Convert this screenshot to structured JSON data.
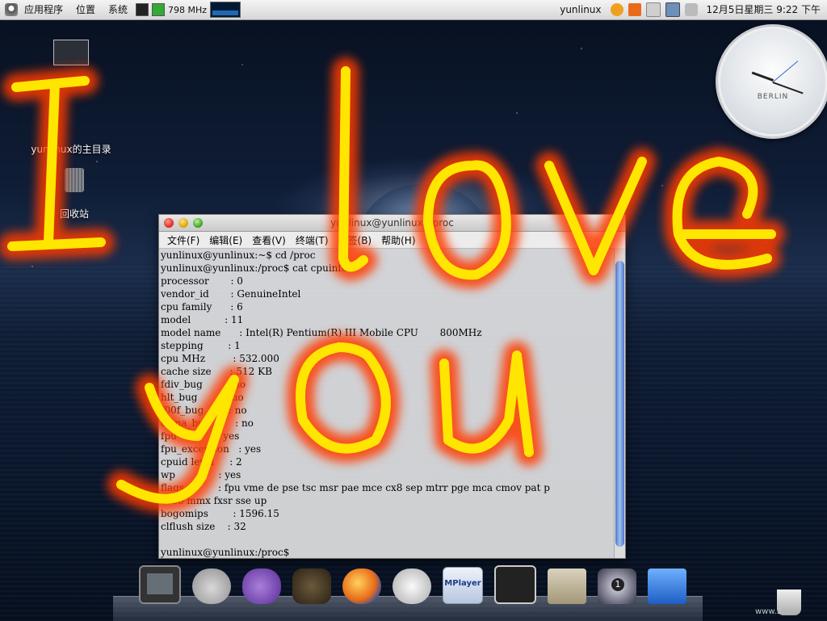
{
  "panel": {
    "menu_apps": "应用程序",
    "menu_places": "位置",
    "menu_system": "系统",
    "cpu_freq": "798 MHz",
    "username": "yunlinux",
    "datetime": "12月5日星期三  9:22 下午"
  },
  "desktop": {
    "home_label": "yunlinux的主目录",
    "trash_label": "回收站"
  },
  "clock": {
    "city": "BERLIN"
  },
  "terminal": {
    "title": "yunlinux@yunlinux: /proc",
    "menu": [
      "文件(F)",
      "编辑(E)",
      "查看(V)",
      "终端(T)",
      "标签(B)",
      "帮助(H)"
    ],
    "lines": [
      "yunlinux@yunlinux:~$ cd /proc",
      "yunlinux@yunlinux:/proc$ cat cpuinfo",
      "processor       : 0",
      "vendor_id       : GenuineIntel",
      "cpu family      : 6",
      "model           : 11",
      "model name      : Intel(R) Pentium(R) III Mobile CPU       800MHz",
      "stepping        : 1",
      "cpu MHz         : 532.000",
      "cache size      : 512 KB",
      "fdiv_bug        : no",
      "hlt_bug         : no",
      "f00f_bug        : no",
      "coma_bug        : no",
      "fpu             : yes",
      "fpu_exception   : yes",
      "cpuid level     : 2",
      "wp              : yes",
      "flags           : fpu vme de pse tsc msr pae mce cx8 sep mtrr pge mca cmov pat p",
      "se36 mmx fxsr sse up",
      "bogomips        : 1596.15",
      "clflush size    : 32",
      "",
      "yunlinux@yunlinux:/proc$"
    ]
  },
  "dock": {
    "items": [
      "terminal-icon",
      "apple-icon",
      "pidgin-icon",
      "gimp-icon",
      "firefox-icon",
      "clock-icon",
      "mplayer-icon",
      "terminal-active-icon",
      "folder-icon",
      "workspace-icon",
      "trash-icon"
    ],
    "mplayer_label": "MPlayer",
    "workspace_badge": "1"
  },
  "overlay": {
    "graffiti_text": "I love you"
  },
  "watermark": "www.2..."
}
